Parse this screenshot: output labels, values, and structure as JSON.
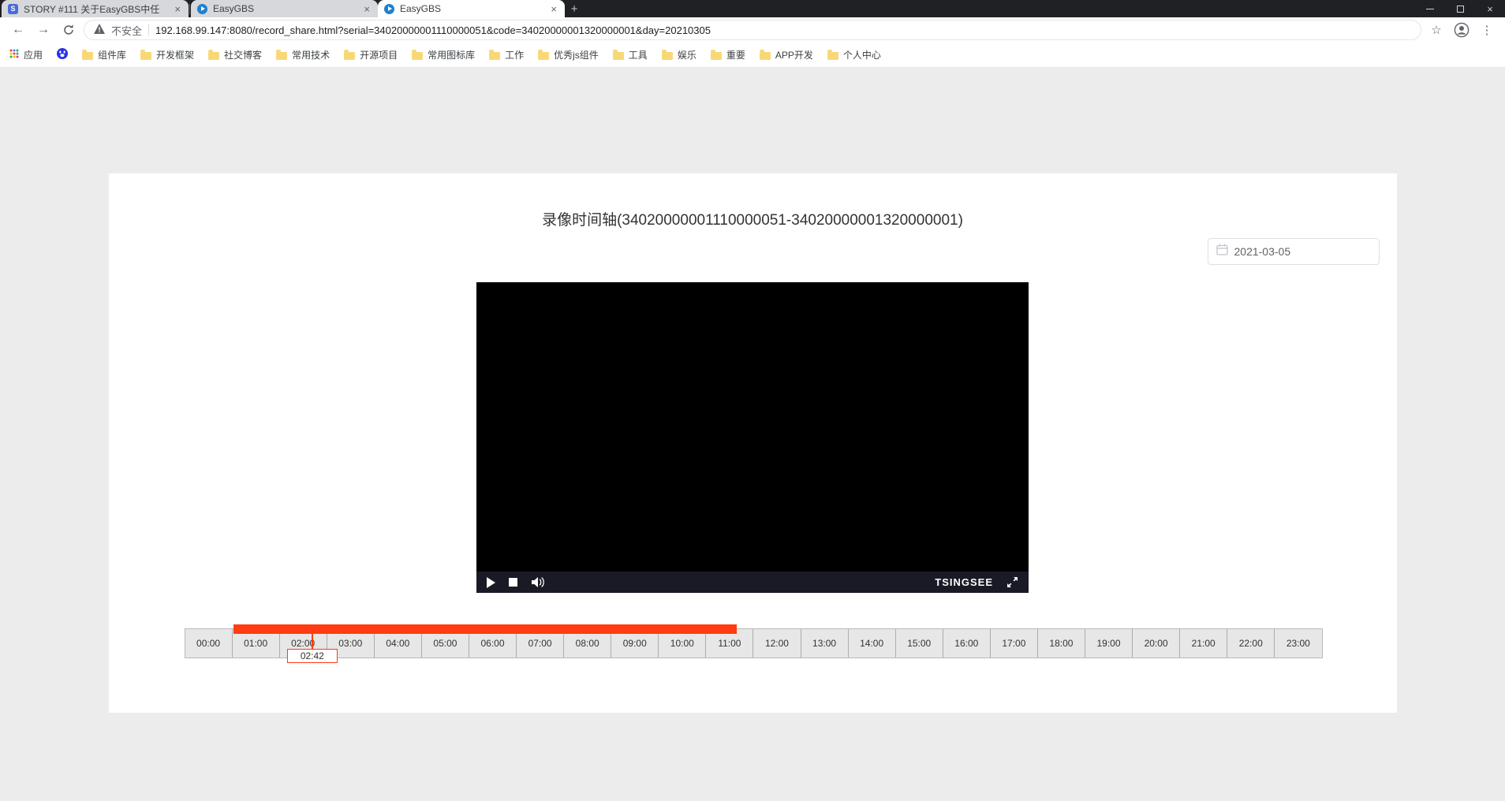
{
  "browser": {
    "tabs": [
      {
        "title": "STORY #111 关于EasyGBS中任",
        "active": false
      },
      {
        "title": "EasyGBS",
        "active": false
      },
      {
        "title": "EasyGBS",
        "active": true
      }
    ],
    "address": {
      "security_label": "不安全",
      "url": "192.168.99.147:8080/record_share.html?serial=34020000001110000051&code=34020000001320000001&day=20210305"
    },
    "bookmarks": {
      "apps_label": "应用",
      "folders": [
        "组件库",
        "开发框架",
        "社交博客",
        "常用技术",
        "开源项目",
        "常用图标库",
        "工作",
        "优秀js组件",
        "工具",
        "娱乐",
        "重要",
        "APP开发",
        "个人中心"
      ]
    }
  },
  "page": {
    "title": "录像时间轴(34020000001110000051-34020000001320000001)",
    "date_picker_value": "2021-03-05",
    "player": {
      "brand": "TSINGSEE"
    },
    "timeline": {
      "hours": [
        "00:00",
        "01:00",
        "02:00",
        "03:00",
        "04:00",
        "05:00",
        "06:00",
        "07:00",
        "08:00",
        "09:00",
        "10:00",
        "11:00",
        "12:00",
        "13:00",
        "14:00",
        "15:00",
        "16:00",
        "17:00",
        "18:00",
        "19:00",
        "20:00",
        "21:00",
        "22:00",
        "23:00"
      ],
      "recording_start_hour": 1.04,
      "recording_end_hour": 11.65,
      "marker_hour": 2.7,
      "marker_label": "02:42",
      "accent_color": "#ff3c12"
    }
  }
}
